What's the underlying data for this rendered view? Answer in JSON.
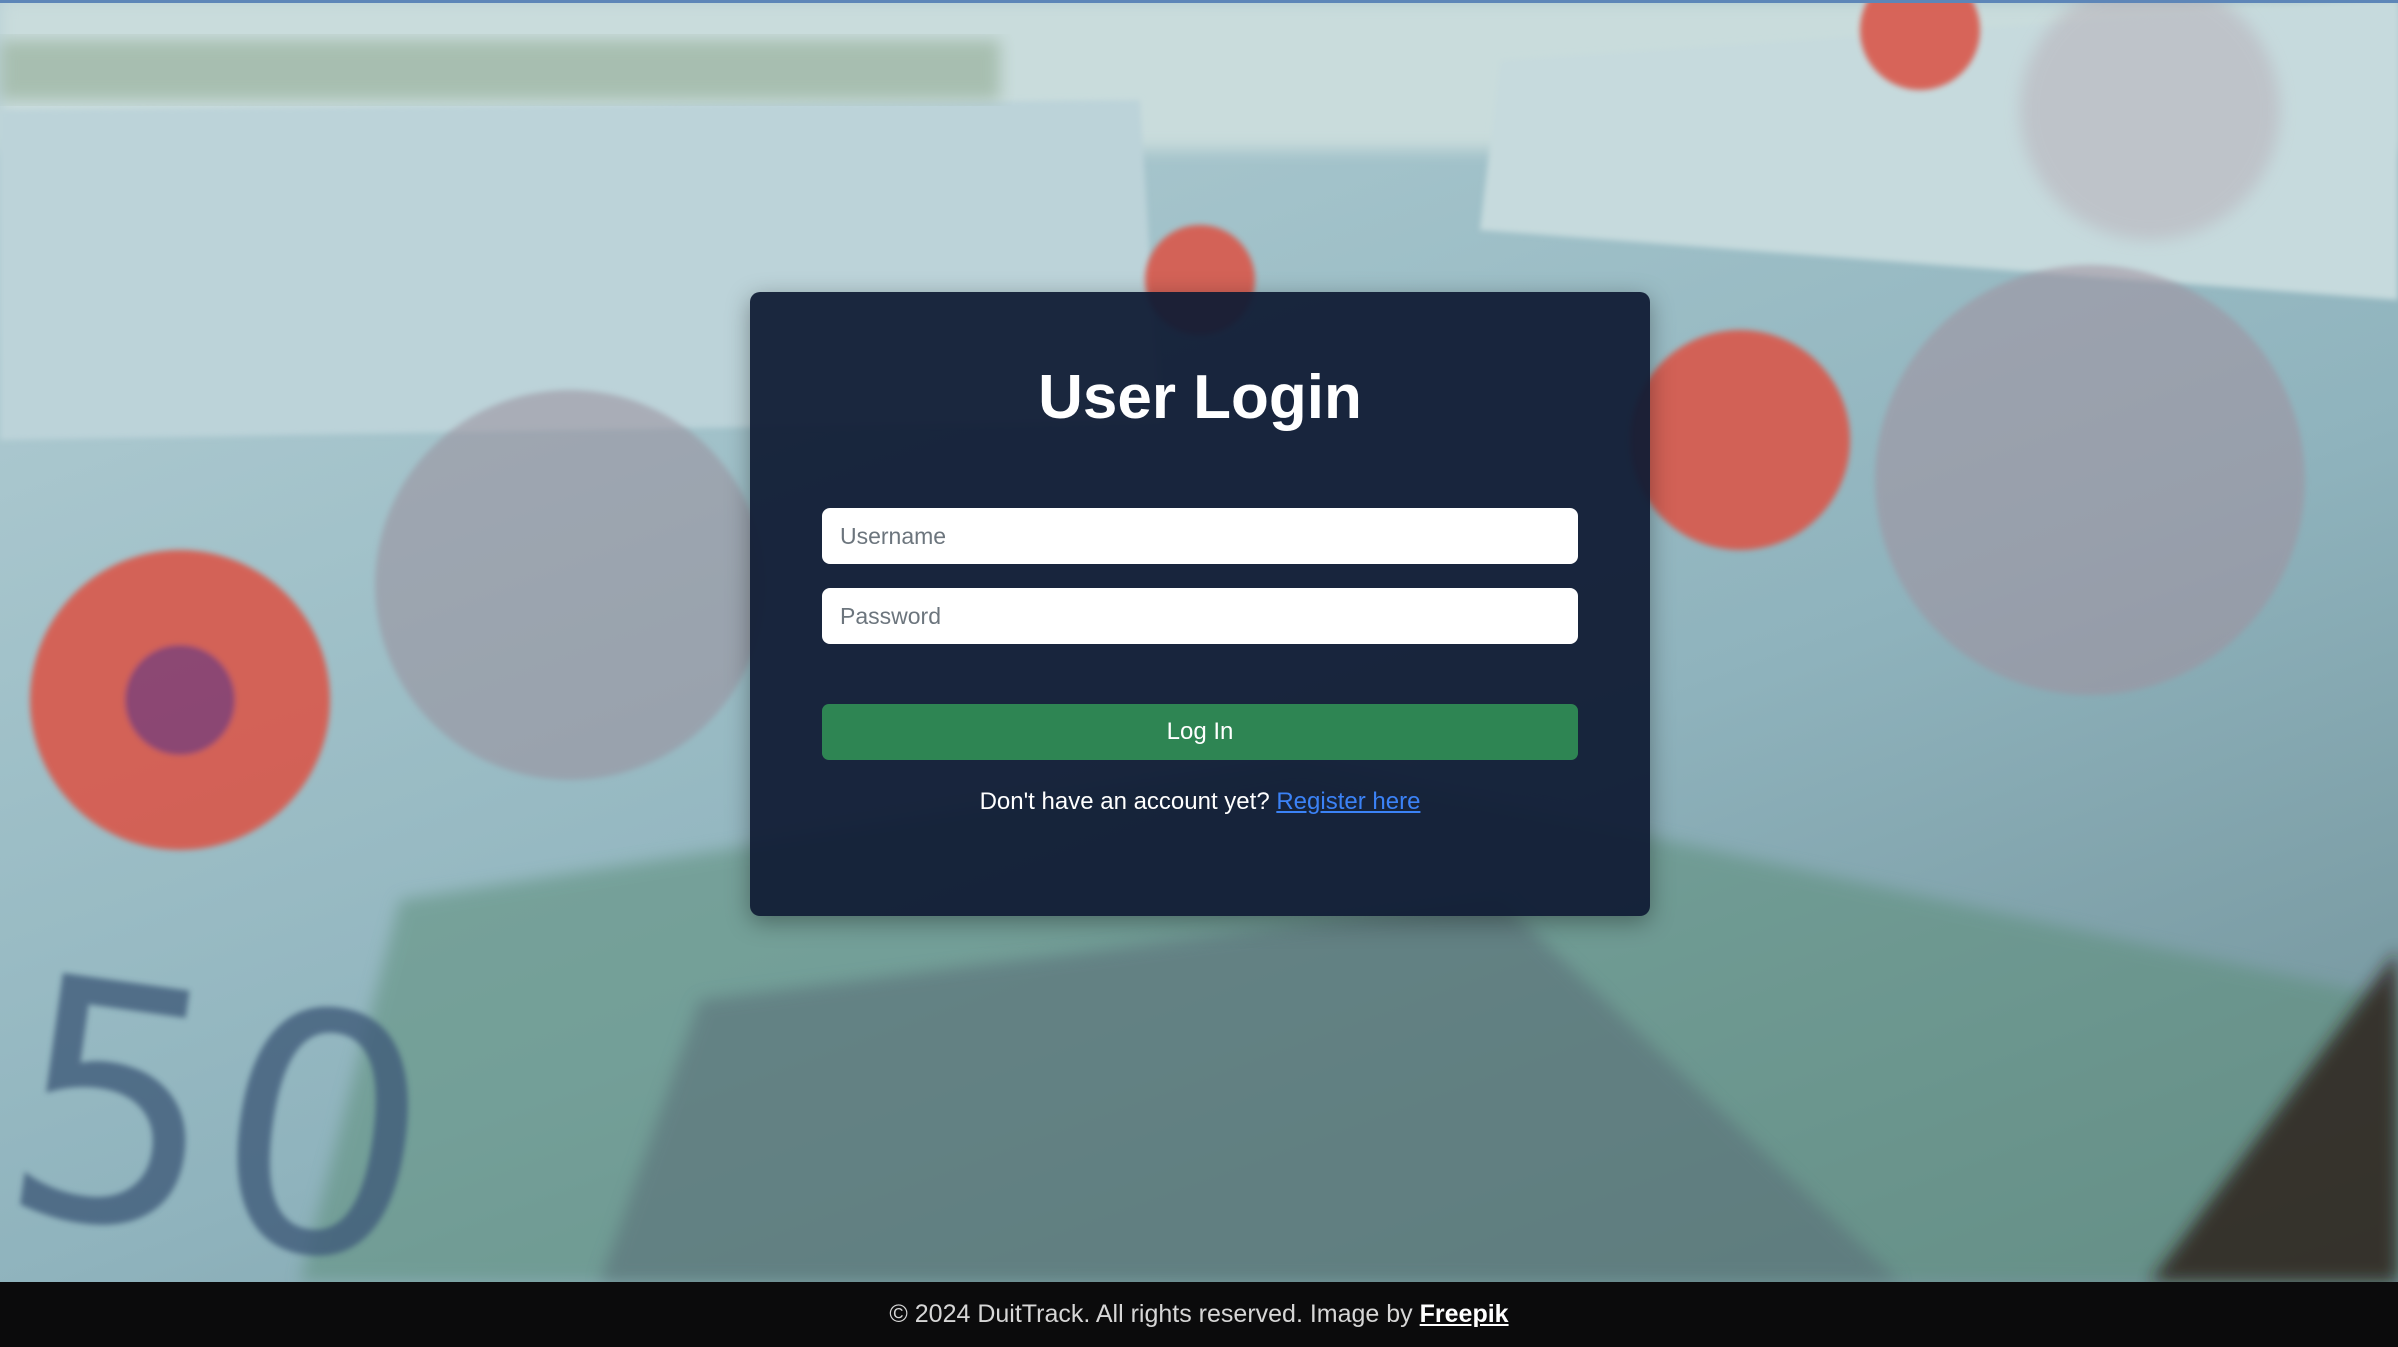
{
  "login": {
    "title": "User Login",
    "username_placeholder": "Username",
    "password_placeholder": "Password",
    "username_value": "",
    "password_value": "",
    "submit_label": "Log In",
    "register_prompt": "Don't have an account yet?",
    "register_link": "Register here"
  },
  "footer": {
    "text": "© 2024 DuitTrack. All rights reserved. Image by",
    "credit_link": "Freepik"
  },
  "colors": {
    "card_bg": "#101c34",
    "button_green": "#2e8553",
    "link_blue": "#3b82f6",
    "footer_bg": "#0b0b0c"
  }
}
